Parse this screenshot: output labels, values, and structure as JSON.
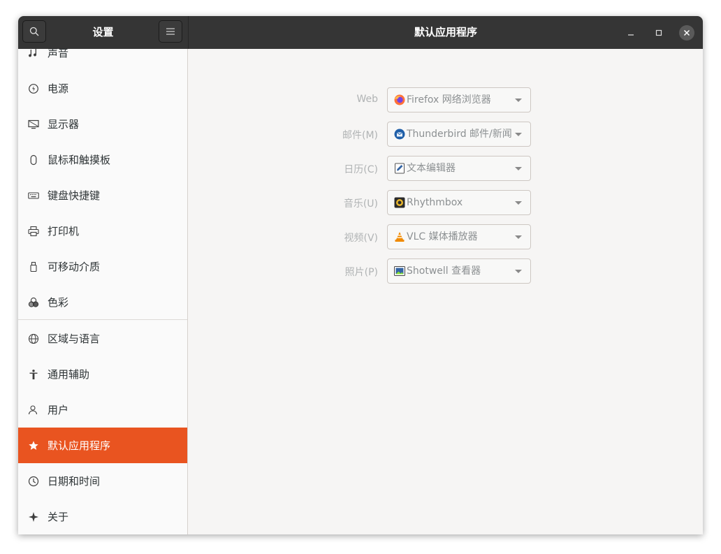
{
  "headerbar": {
    "left_title": "设置",
    "title": "默认应用程序"
  },
  "sidebar": {
    "items": [
      {
        "label": "声音",
        "icon": "music-note-icon"
      },
      {
        "label": "电源",
        "icon": "power-icon"
      },
      {
        "label": "显示器",
        "icon": "display-icon"
      },
      {
        "label": "鼠标和触摸板",
        "icon": "mouse-icon"
      },
      {
        "label": "键盘快捷键",
        "icon": "keyboard-icon"
      },
      {
        "label": "打印机",
        "icon": "printer-icon"
      },
      {
        "label": "可移动介质",
        "icon": "usb-drive-icon"
      },
      {
        "label": "色彩",
        "icon": "color-icon"
      },
      {
        "label": "区域与语言",
        "icon": "globe-icon"
      },
      {
        "label": "通用辅助",
        "icon": "accessibility-icon"
      },
      {
        "label": "用户",
        "icon": "users-icon"
      },
      {
        "label": "默认应用程序",
        "icon": "star-icon",
        "selected": true
      },
      {
        "label": "日期和时间",
        "icon": "clock-icon"
      },
      {
        "label": "关于",
        "icon": "sparkle-icon"
      }
    ]
  },
  "defaults": [
    {
      "label": "Web",
      "value": "Firefox 网络浏览器",
      "icon": "firefox-icon"
    },
    {
      "label": "邮件(M)",
      "value": "Thunderbird 邮件/新闻",
      "icon": "thunderbird-icon"
    },
    {
      "label": "日历(C)",
      "value": "文本编辑器",
      "icon": "text-editor-icon"
    },
    {
      "label": "音乐(U)",
      "value": "Rhythmbox",
      "icon": "rhythmbox-icon"
    },
    {
      "label": "视频(V)",
      "value": "VLC 媒体播放器",
      "icon": "vlc-icon"
    },
    {
      "label": "照片(P)",
      "value": "Shotwell 查看器",
      "icon": "shotwell-icon"
    }
  ],
  "colors": {
    "accent": "#e95420",
    "headerbar": "#353535"
  }
}
